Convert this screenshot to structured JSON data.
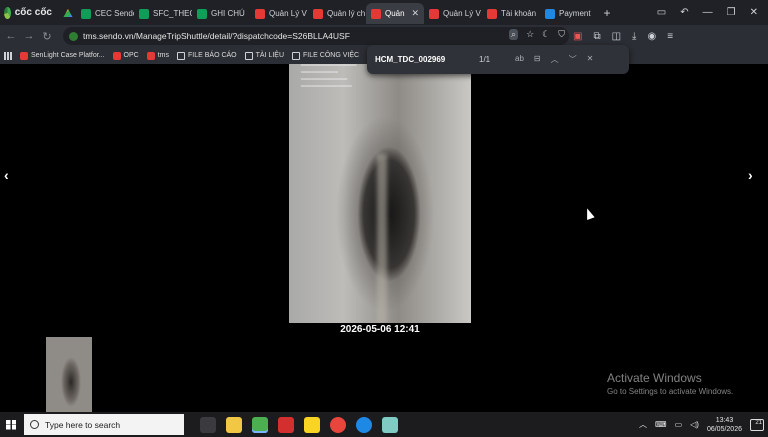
{
  "browser": {
    "brand": "cốc cốc",
    "tabs": [
      {
        "label": "",
        "icon": "google-drive-icon",
        "active": false
      },
      {
        "label": "CEC Sendo",
        "icon": "sheets-icon",
        "active": false
      },
      {
        "label": "SFC_THEO",
        "icon": "sheets-icon",
        "active": false
      },
      {
        "label": "GHI CHÚ",
        "icon": "sheets-icon",
        "active": false
      },
      {
        "label": "Quản Lý V",
        "icon": "sendo-icon",
        "active": false
      },
      {
        "label": "Quản lý ch",
        "icon": "sendo-icon",
        "active": false
      },
      {
        "label": "Quản",
        "icon": "sendo-icon",
        "active": true
      },
      {
        "label": "Quản Lý V",
        "icon": "sendo-icon",
        "active": false
      },
      {
        "label": "Tài khoản",
        "icon": "sendo-icon",
        "active": false
      },
      {
        "label": "Payment",
        "icon": "payment-icon",
        "active": false
      }
    ],
    "url": "tms.sendo.vn/ManageTripShuttle/detail/?dispatchcode=S26BLLA4USF",
    "bookmarks": [
      {
        "label": "SenLight Case Platfor...",
        "icon": "sendo-icon"
      },
      {
        "label": "OPC",
        "icon": "sendo-icon"
      },
      {
        "label": "tms",
        "icon": "sendo-icon"
      },
      {
        "label": "FILE BÁO CÁO",
        "icon": "folder-icon"
      },
      {
        "label": "TÀI LIỆU",
        "icon": "folder-icon"
      },
      {
        "label": "FILE CÔNG VIỆC",
        "icon": "folder-icon"
      }
    ]
  },
  "find": {
    "query": "HCM_TDC_002969",
    "count": "1/1",
    "case_label": "ab"
  },
  "viewer": {
    "prev_symbol": "‹",
    "next_symbol": "›",
    "caption": "2026-05-06 12:41",
    "activate_title": "Activate Windows",
    "activate_sub": "Go to Settings to activate Windows."
  },
  "taskbar": {
    "search_placeholder": "Type here to search",
    "time": "13:43",
    "date": "06/05/2026",
    "notif_count": "21",
    "apps": [
      {
        "name": "task-view",
        "color": "#3a3a3f"
      },
      {
        "name": "file-explorer",
        "color": "#f2c744"
      },
      {
        "name": "coccoc",
        "color": "#4caf50"
      },
      {
        "name": "wps",
        "color": "#d32f2f"
      },
      {
        "name": "sticky-notes",
        "color": "#f9d423"
      },
      {
        "name": "chrome",
        "color": "#e8453c"
      },
      {
        "name": "zalo",
        "color": "#1e88e5"
      },
      {
        "name": "notepad",
        "color": "#80cbc4"
      }
    ]
  }
}
